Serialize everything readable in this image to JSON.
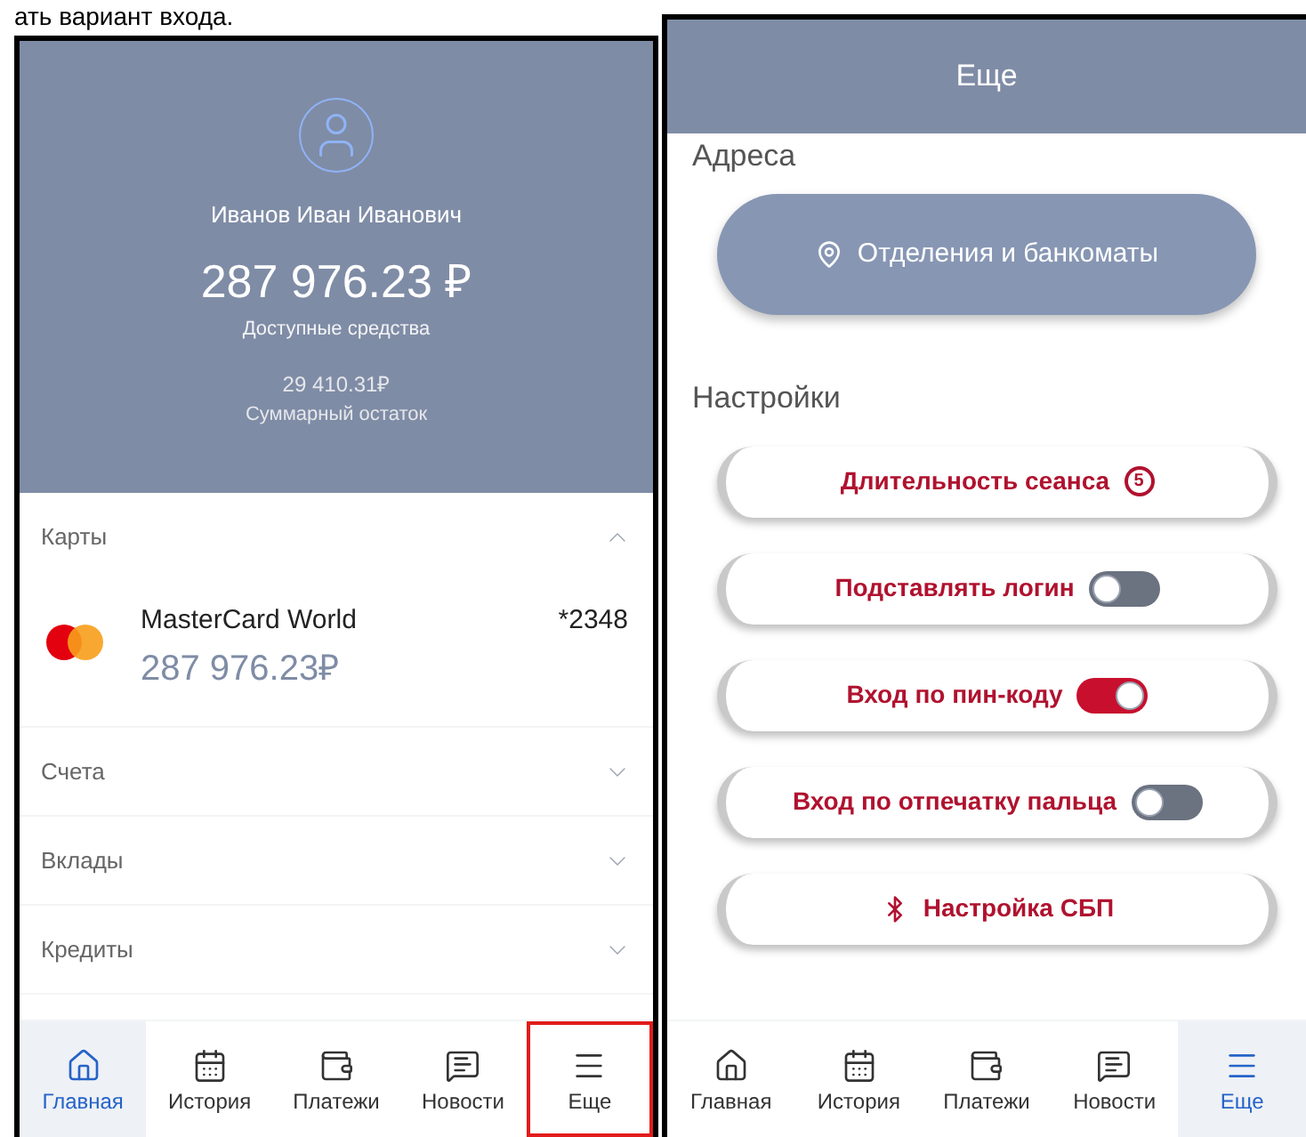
{
  "document_text": "ать вариант входа.",
  "home_screen": {
    "user_name": "Иванов Иван Иванович",
    "balance": "287 976.23 ₽",
    "balance_label": "Доступные средства",
    "total": "29 410.31₽",
    "total_label": "Суммарный остаток",
    "sections": [
      {
        "title": "Карты",
        "expanded": true,
        "cards": [
          {
            "name": "MasterCard World",
            "number": "*2348",
            "amount": "287 976.23₽"
          }
        ]
      },
      {
        "title": "Счета",
        "expanded": false
      },
      {
        "title": "Вклады",
        "expanded": false
      },
      {
        "title": "Кредиты",
        "expanded": false
      }
    ],
    "nav": [
      {
        "label": "Главная",
        "selected": true,
        "highlighted": false
      },
      {
        "label": "История",
        "selected": false,
        "highlighted": false
      },
      {
        "label": "Платежи",
        "selected": false,
        "highlighted": false
      },
      {
        "label": "Новости",
        "selected": false,
        "highlighted": false
      },
      {
        "label": "Еще",
        "selected": false,
        "highlighted": true
      }
    ]
  },
  "more_screen": {
    "title": "Еще",
    "addresses_title": "Адреса",
    "branches_button": "Отделения и банкоматы",
    "settings_title": "Настройки",
    "settings": [
      {
        "kind": "badge",
        "label": "Длительность сеанса",
        "badge": "5"
      },
      {
        "kind": "toggle",
        "label": "Подставлять логин",
        "on": false
      },
      {
        "kind": "toggle",
        "label": "Вход по пин-коду",
        "on": true
      },
      {
        "kind": "toggle",
        "label": "Вход по отпечатку пальца",
        "on": false
      },
      {
        "kind": "link",
        "label": "Настройка СБП"
      }
    ],
    "nav": [
      {
        "label": "Главная",
        "selected": false,
        "highlighted": false
      },
      {
        "label": "История",
        "selected": false,
        "highlighted": false
      },
      {
        "label": "Платежи",
        "selected": false,
        "highlighted": false
      },
      {
        "label": "Новости",
        "selected": false,
        "highlighted": false
      },
      {
        "label": "Еще",
        "selected": true,
        "highlighted": false
      }
    ]
  }
}
